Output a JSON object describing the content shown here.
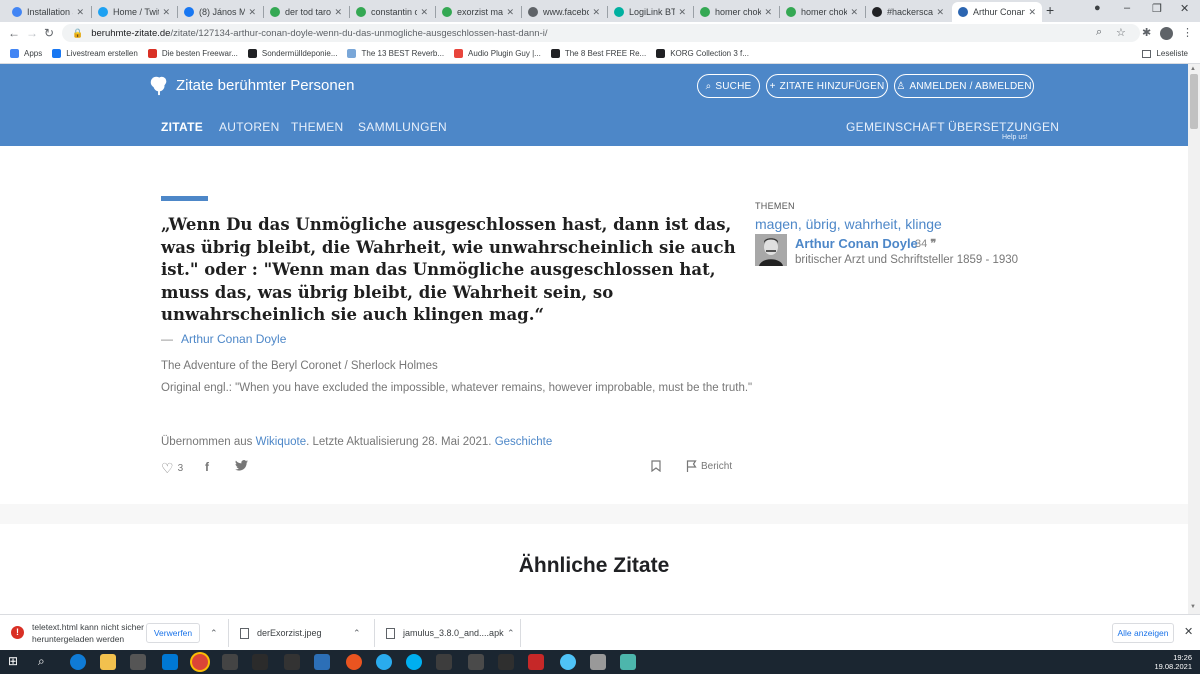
{
  "browser": {
    "tabs": [
      {
        "label": "Installation a",
        "color": "#4285f4"
      },
      {
        "label": "Home / Twitte",
        "color": "#1da1f2"
      },
      {
        "label": "(8) János Mos",
        "color": "#1877f2"
      },
      {
        "label": "der tod tarot",
        "color": "#34a853"
      },
      {
        "label": "constantin ca",
        "color": "#34a853"
      },
      {
        "label": "exorzist male",
        "color": "#34a853"
      },
      {
        "label": "www.faceboo",
        "color": "#5f6368"
      },
      {
        "label": "LogiLink BT00",
        "color": "#00b0a0"
      },
      {
        "label": "homer chokin",
        "color": "#34a853"
      },
      {
        "label": "homer chokin",
        "color": "#34a853"
      },
      {
        "label": "#hackerscard",
        "color": "#202124"
      },
      {
        "label": "Arthur Conan",
        "color": "#2b65b1"
      }
    ],
    "url_host": "beruhmte-zitate.de",
    "url_path": "/zitate/127134-arthur-conan-doyle-wenn-du-das-unmogliche-ausgeschlossen-hast-dann-i/",
    "bookmarks": [
      {
        "label": "Apps",
        "color": "#4285f4"
      },
      {
        "label": "Livestream erstellen",
        "color": "#1877f2"
      },
      {
        "label": "Die besten Freewar...",
        "color": "#d93025"
      },
      {
        "label": "Sondermülldeponie...",
        "color": "#202124"
      },
      {
        "label": "The 13 BEST Reverb...",
        "color": "#7aa7d8"
      },
      {
        "label": "Audio Plugin Guy |...",
        "color": "#e8453c"
      },
      {
        "label": "The 8 Best FREE Re...",
        "color": "#202124"
      },
      {
        "label": "KORG Collection 3 f...",
        "color": "#202124"
      }
    ],
    "reading_list": "Leseliste"
  },
  "site": {
    "logo": "Zitate berühmter Personen",
    "search_btn": "SUCHE",
    "add_btn": "ZITATE HINZUFÜGEN",
    "login_btn": "ANMELDEN / ABMELDEN",
    "nav": [
      "ZITATE",
      "AUTOREN",
      "THEMEN",
      "SAMMLUNGEN"
    ],
    "nav_right": [
      "GEMEINSCHAFT",
      "ÜBERSETZUNGEN"
    ],
    "help_us": "Help us!",
    "brand_color": "#4d87c8"
  },
  "quote": {
    "text": "„Wenn Du das Unmögliche ausgeschlossen hast, dann ist das, was übrig bleibt, die Wahrheit, wie unwahrscheinlich sie auch ist.\" oder : \"Wenn man das Unmögliche ausgeschlossen hat, muss das, was übrig bleibt, die Wahrheit sein, so unwahrscheinlich sie auch klingen mag.“",
    "dash": "—",
    "author": "Arthur Conan Doyle",
    "source": "The Adventure of the Beryl Coronet / Sherlock Holmes",
    "original": "Original engl.: \"When you have excluded the impossible, whatever remains, however improbable, must be the truth.\"",
    "meta_prefix": "Übernommen aus",
    "meta_link": "Wikiquote",
    "meta_mid": ". Letzte Aktualisierung 28. Mai 2021.",
    "meta_history": "Geschichte",
    "likes": "3",
    "report": "Bericht"
  },
  "sidebar": {
    "themes_heading": "THEMEN",
    "themes": [
      "magen",
      "übrig",
      "wahrheit",
      "klinge"
    ],
    "author_name": "Arthur Conan Doyle",
    "author_count": "34",
    "author_desc": "britischer Arzt und Schriftsteller 1859 - 1930"
  },
  "similar_heading": "Ähnliche Zitate",
  "downloads": {
    "warning_line1": "teletext.html kann nicht sicher",
    "warning_line2": "heruntergeladen werden",
    "discard": "Verwerfen",
    "file1": "derExorzist.jpeg",
    "file2": "jamulus_3.8.0_and....apk",
    "show_all": "Alle anzeigen"
  },
  "taskbar": {
    "time": "19:26",
    "date": "19.08.2021"
  }
}
